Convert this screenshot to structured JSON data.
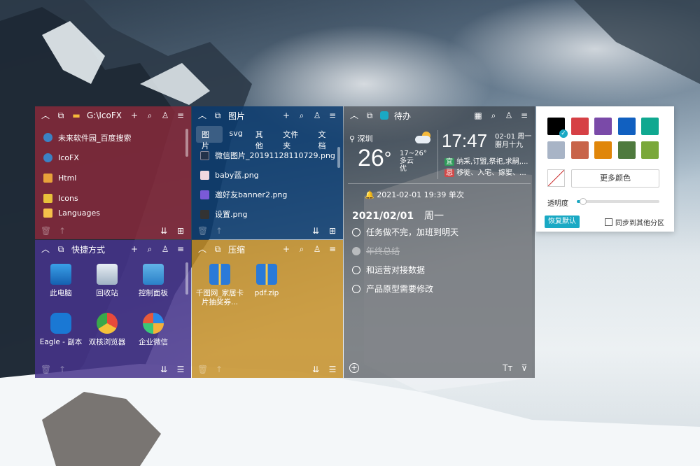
{
  "desktop": {
    "accent": "#1aa9c4"
  },
  "panel_icofx": {
    "title": "G:\\IcoFX",
    "color": "#8b2a3a",
    "items": [
      {
        "label": "未来软件园_百度搜索",
        "icon": "browser-file-icon"
      },
      {
        "label": "IcoFX",
        "icon": "browser-file-icon"
      },
      {
        "label": "Html",
        "icon": "html-file-icon"
      },
      {
        "label": "Icons",
        "icon": "icons-file-icon"
      },
      {
        "label": "Languages",
        "icon": "folder-icon"
      }
    ]
  },
  "panel_pictures": {
    "title": "图片",
    "tabs": [
      "图片",
      "svg",
      "其他",
      "文件夹",
      "文档"
    ],
    "items": [
      {
        "label": "微信图片_20191128110729.png"
      },
      {
        "label": "baby蓝.png"
      },
      {
        "label": "邀好友banner2.png"
      },
      {
        "label": "设置.png"
      }
    ]
  },
  "panel_shortcuts": {
    "title": "快捷方式",
    "items": [
      {
        "label": "此电脑",
        "icon": "computer-icon"
      },
      {
        "label": "回收站",
        "icon": "recycle-bin-icon"
      },
      {
        "label": "控制面板",
        "icon": "control-panel-icon"
      },
      {
        "label": "Eagle - 副本",
        "icon": "eagle-app-icon"
      },
      {
        "label": "双核浏览器",
        "icon": "browser-app-icon"
      },
      {
        "label": "企业微信",
        "icon": "wecom-app-icon"
      }
    ]
  },
  "panel_zip": {
    "title": "压缩",
    "items": [
      {
        "label": "千图网_家居卡片抽奖券...",
        "icon": "zip-file-icon"
      },
      {
        "label": "pdf.zip",
        "icon": "zip-file-icon"
      }
    ]
  },
  "panel_todo": {
    "title": "待办",
    "weather": {
      "city": "深圳",
      "temp": "26",
      "degree": "°",
      "range": "17~26°",
      "condition": "多云",
      "quality": "优"
    },
    "clock": {
      "time": "17:47",
      "date": "02-01 周一",
      "lunar": "腊月十九",
      "good_tag": "宜",
      "good_text": "纳采,订盟,祭祀,求嗣,...",
      "bad_tag": "忌",
      "bad_text": "移徙、入宅、嫁娶、..."
    },
    "reminder": "2021-02-01 19:39  单次",
    "date_heading": "2021/02/01",
    "weekday": "周一",
    "tasks": [
      {
        "text": "任务做不完，加班到明天",
        "done": false
      },
      {
        "text": "年终总结",
        "done": true
      },
      {
        "text": "和运营对接数据",
        "done": false
      },
      {
        "text": "产品原型需要修改",
        "done": false
      }
    ]
  },
  "color_picker": {
    "swatches": [
      "#000000",
      "#d64045",
      "#7a4aa8",
      "#1160c0",
      "#10a890",
      "#a8b4c6",
      "#c8644a",
      "#e0860a",
      "#4f7a3e",
      "#7aa83a"
    ],
    "more_colors": "更多颜色",
    "opacity_label": "透明度",
    "opacity_value": 0.08,
    "restore_default": "恢复默认",
    "sync_label": "同步到其他分区"
  }
}
